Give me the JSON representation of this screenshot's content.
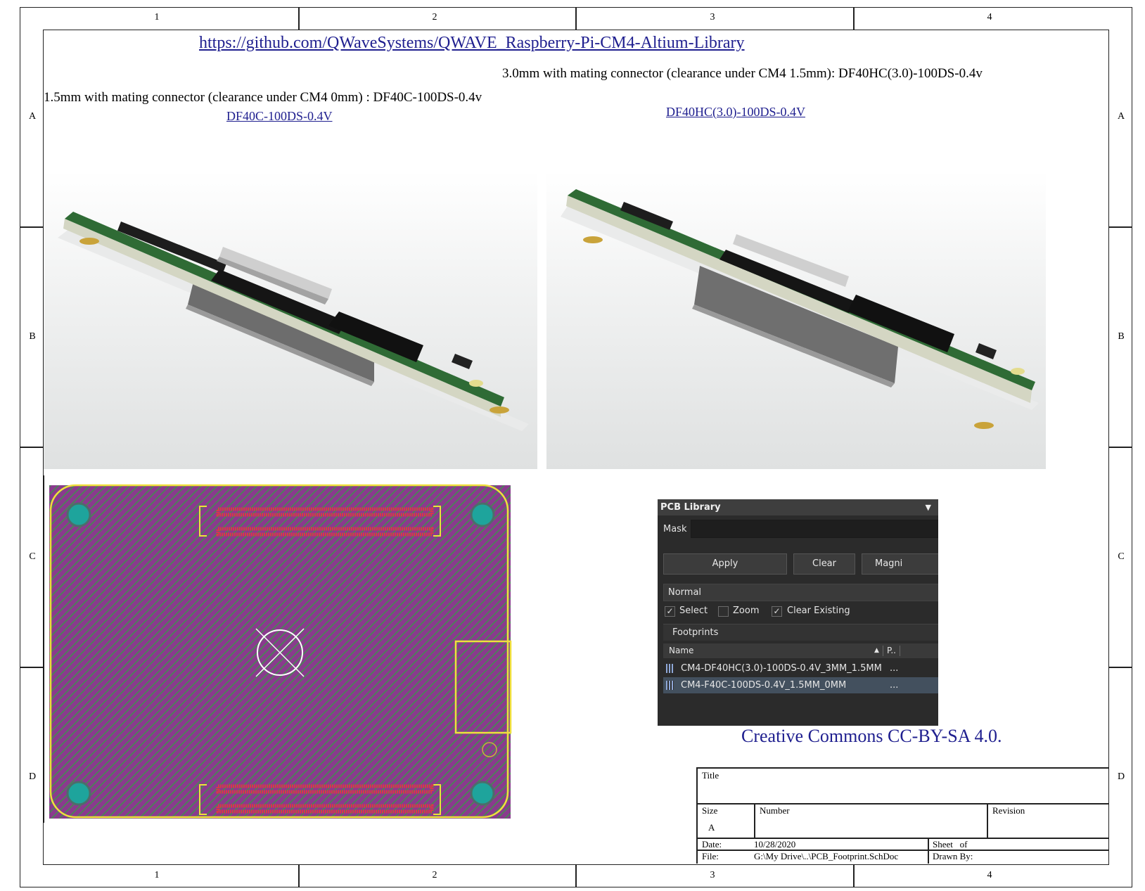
{
  "sheet": {
    "zone_numbers": [
      "1",
      "2",
      "3",
      "4"
    ],
    "zone_letters": [
      "A",
      "B",
      "C",
      "D"
    ]
  },
  "header": {
    "repo_link": "https://github.com/QWaveSystems/QWAVE_Raspberry-Pi-CM4-Altium-Library",
    "note_3mm": "3.0mm with mating connector (clearance under CM4 1.5mm): DF40HC(3.0)-100DS-0.4v",
    "note_1p5mm": "1.5mm with mating connector (clearance under CM4 0mm) : DF40C-100DS-0.4v",
    "link_df40c": "DF40C-100DS-0.4V",
    "link_df40hc": "DF40HC(3.0)-100DS-0.4V"
  },
  "pcb_library": {
    "title": "PCB Library",
    "mask_label": "Mask",
    "mask_value": "",
    "buttons": {
      "apply": "Apply",
      "clear": "Clear",
      "magnify": "Magni"
    },
    "mode": "Normal",
    "options": [
      {
        "label": "Select",
        "checked": true
      },
      {
        "label": "Zoom",
        "checked": false
      },
      {
        "label": "Clear Existing",
        "checked": true
      }
    ],
    "section": "Footprints",
    "columns": {
      "name": "Name",
      "pads": "P.."
    },
    "rows": [
      {
        "name": "CM4-DF40HC(3.0)-100DS-0.4V_3MM_1.5MM",
        "pads": "...",
        "selected": false
      },
      {
        "name": "CM4-F40C-100DS-0.4V_1.5MM_0MM",
        "pads": "...",
        "selected": true
      }
    ]
  },
  "license": "Creative Commons CC-BY-SA 4.0.",
  "title_block": {
    "title_label": "Title",
    "size_label": "Size",
    "size_value": "A",
    "number_label": "Number",
    "revision_label": "Revision",
    "date_label": "Date:",
    "date_value": "10/28/2020",
    "sheet_label": "Sheet   of",
    "file_label": "File:",
    "file_value": "G:\\My Drive\\..\\PCB_Footprint.SchDoc",
    "drawn_by_label": "Drawn By:"
  },
  "colors": {
    "link": "#1f1f8f",
    "pcb_fill": "#8a3a8e",
    "pcb_outline": "#f0e03c",
    "pad_red": "#d8384a",
    "mount_hole": "#1ea49c",
    "board_green": "#2f6b35"
  }
}
